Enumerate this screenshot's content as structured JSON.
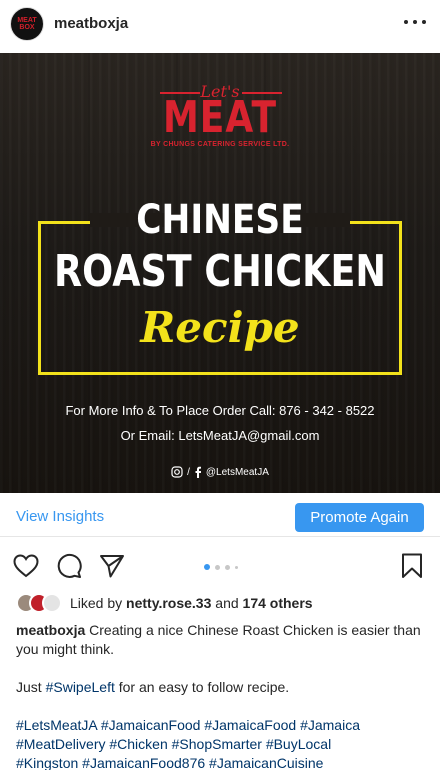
{
  "header": {
    "avatar_text_line1": "MEAT",
    "avatar_text_line2": "BOX",
    "username": "meatboxja"
  },
  "post_image": {
    "brand_script": "Let's",
    "brand_main": "MEAT",
    "brand_sub": "BY CHUNGS CATERING SERVICE LTD.",
    "title_line1": "CHINESE",
    "title_line2": "ROAST CHICKEN",
    "title_line3": "Recipe",
    "info_line1": "For More Info & To Place Order Call: 876 - 342 - 8522",
    "info_line2": "Or Email: LetsMeatJA@gmail.com",
    "social_handle": "@LetsMeatJA",
    "colors": {
      "brand_red": "#d8232f",
      "accent_yellow": "#f3e21b"
    }
  },
  "insights": {
    "view_insights_label": "View Insights",
    "promote_label": "Promote Again",
    "accent": "#3897f0"
  },
  "actions": {
    "icons": [
      "heart-icon",
      "comment-icon",
      "share-icon",
      "bookmark-icon"
    ],
    "carousel_count": 4,
    "carousel_active": 0
  },
  "likes": {
    "prefix": "Liked by",
    "first_user": "netty.rose.33",
    "connector": "and",
    "others": "174 others"
  },
  "caption": {
    "username": "meatboxja",
    "text1": "Creating a nice Chinese Roast Chicken is easier than you might think.",
    "text2_before": "Just",
    "text2_tag": "#SwipeLeft",
    "text2_after": "for an easy to follow recipe.",
    "hashtags": [
      "#LetsMeatJA",
      "#JamaicanFood",
      "#JamaicaFood",
      "#Jamaica",
      "#MeatDelivery",
      "#Chicken",
      "#ShopSmarter",
      "#BuyLocal",
      "#Kingston",
      "#JamaicanFood876",
      "#JamaicanCuisine"
    ]
  }
}
